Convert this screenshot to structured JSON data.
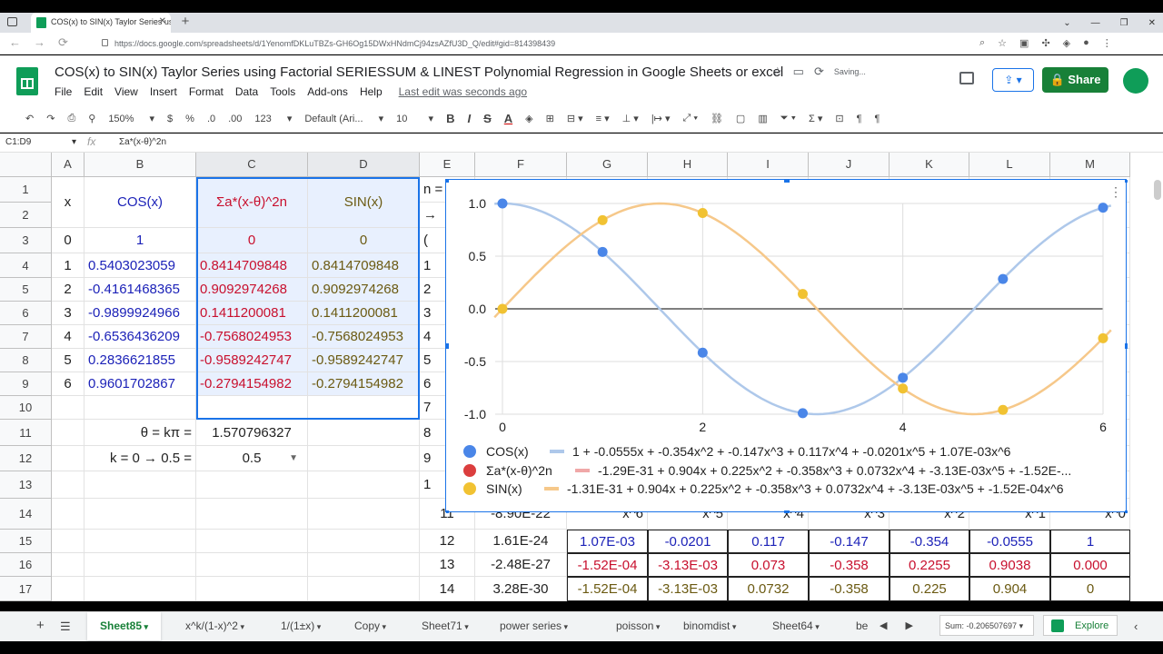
{
  "browser": {
    "tab_title": "COS(x) to SIN(x) Taylor Series us",
    "url": "https://docs.google.com/spreadsheets/d/1YenomfDKLuTBZs-GH6Og15DWxHNdmCj94zsAZfU3D_Q/edit#gid=814398439"
  },
  "doc": {
    "title": "COS(x) to SIN(x) Taylor Series using Factorial SERIESSUM & LINEST Polynomial Regression in Google Sheets or excel",
    "saving": "Saving...",
    "menu": [
      "File",
      "Edit",
      "View",
      "Insert",
      "Format",
      "Data",
      "Tools",
      "Add-ons",
      "Help"
    ],
    "last_edit": "Last edit was seconds ago",
    "share_label": "Share"
  },
  "toolbar": {
    "zoom": "150%",
    "currency": "$",
    "percent": "%",
    "dec_less": ".0",
    "dec_more": ".00",
    "format_num": "123",
    "font": "Default (Ari...",
    "size": "10",
    "bold": "B",
    "italic": "I",
    "strike": "S",
    "textcolor": "A"
  },
  "formula_bar": {
    "name_box": "C1:D9",
    "fx": "fx",
    "formula": "Σa*(x-θ)^2n"
  },
  "columns": [
    "A",
    "B",
    "C",
    "D",
    "E",
    "F",
    "G",
    "H",
    "I",
    "J",
    "K",
    "L",
    "M"
  ],
  "rows": [
    "1",
    "2",
    "3",
    "4",
    "5",
    "6",
    "7",
    "8",
    "9",
    "10",
    "11",
    "12",
    "13",
    "14",
    "15",
    "16",
    "17"
  ],
  "table": {
    "headers": [
      "x",
      "COS(x)",
      "Σa*(x-θ)^2n",
      "SIN(x)"
    ],
    "header_n": "n =",
    "header_arrow": "→",
    "data": [
      [
        "0",
        "1",
        "0",
        "0"
      ],
      [
        "1",
        "0.5403023059",
        "0.8414709848",
        "0.8414709848"
      ],
      [
        "2",
        "-0.4161468365",
        "0.9092974268",
        "0.9092974268"
      ],
      [
        "3",
        "-0.9899924966",
        "0.1411200081",
        "0.1411200081"
      ],
      [
        "4",
        "-0.6536436209",
        "-0.7568024953",
        "-0.7568024953"
      ],
      [
        "5",
        "0.2836621855",
        "-0.9589242747",
        "-0.9589242747"
      ],
      [
        "6",
        "0.9601702867",
        "-0.2794154982",
        "-0.2794154982"
      ]
    ],
    "e_partial": [
      "(",
      "1",
      "2",
      "3",
      "4",
      "5",
      "6",
      "7",
      "8",
      "9",
      "1"
    ],
    "theta_label": "θ = kπ =",
    "theta_value": "1.570796327",
    "k_label": "k = 0  → 0.5 =",
    "k_value": "0.5"
  },
  "lower_table": {
    "e_values": [
      "11",
      "12",
      "13",
      "14"
    ],
    "f_values": [
      "-8.90E-22",
      "1.61E-24",
      "-2.48E-27",
      "3.28E-30"
    ],
    "powers": [
      "x^6",
      "x^5",
      "x^4",
      "x^3",
      "x^2",
      "x^1",
      "x^0"
    ],
    "row_blue": [
      "1.07E-03",
      "-0.0201",
      "0.117",
      "-0.147",
      "-0.354",
      "-0.0555",
      "1"
    ],
    "row_red": [
      "-1.52E-04",
      "-3.13E-03",
      "0.073",
      "-0.358",
      "0.2255",
      "0.9038",
      "0.000"
    ],
    "row_olive": [
      "-1.52E-04",
      "-3.13E-03",
      "0.0732",
      "-0.358",
      "0.225",
      "0.904",
      "0"
    ]
  },
  "chart_data": {
    "type": "scatter",
    "xlim": [
      0,
      6
    ],
    "ylim": [
      -1,
      1
    ],
    "x_ticks": [
      "0",
      "2",
      "4",
      "6"
    ],
    "y_ticks": [
      "1.0",
      "0.5",
      "0.0",
      "-0.5",
      "-1.0"
    ],
    "grid": true,
    "legend_position": "bottom",
    "series": [
      {
        "name": "COS(x)",
        "color": "#4a86e8",
        "trend_color": "#aec8ea",
        "x": [
          0,
          1,
          2,
          3,
          4,
          5,
          6
        ],
        "y": [
          1,
          0.5403,
          -0.4161,
          -0.99,
          -0.6536,
          0.2837,
          0.9602
        ],
        "trendline": "1 + -0.0555x + -0.354x^2 + -0.147x^3 + 0.117x^4 + -0.0201x^5 + 1.07E-03x^6"
      },
      {
        "name": "Σa*(x-θ)^2n",
        "color": "#db3e3e",
        "trend_color": "#f0a8a8",
        "x": [
          0,
          1,
          2,
          3,
          4,
          5,
          6
        ],
        "y": [
          0,
          0.8415,
          0.9093,
          0.1411,
          -0.7568,
          -0.9589,
          -0.2794
        ],
        "trendline": "-1.29E-31 + 0.904x + 0.225x^2 + -0.358x^3 + 0.0732x^4 + -3.13E-03x^5 + -1.52E-..."
      },
      {
        "name": "SIN(x)",
        "color": "#f1c232",
        "trend_color": "#f6c88a",
        "x": [
          0,
          1,
          2,
          3,
          4,
          5,
          6
        ],
        "y": [
          0,
          0.8415,
          0.9093,
          0.1411,
          -0.7568,
          -0.9589,
          -0.2794
        ],
        "trendline": "-1.31E-31 + 0.904x + 0.225x^2 + -0.358x^3 + 0.0732x^4 + -3.13E-03x^5 + -1.52E-04x^6"
      }
    ]
  },
  "sheet_tabs": [
    "Sheet85",
    "x^k/(1-x)^2",
    "1/(1±x)",
    "Copy",
    "Sheet71",
    "power series",
    "poisson",
    "binomdist",
    "Sheet64",
    "be"
  ],
  "status": {
    "sum": "Sum: -0.206507697",
    "explore": "Explore"
  }
}
